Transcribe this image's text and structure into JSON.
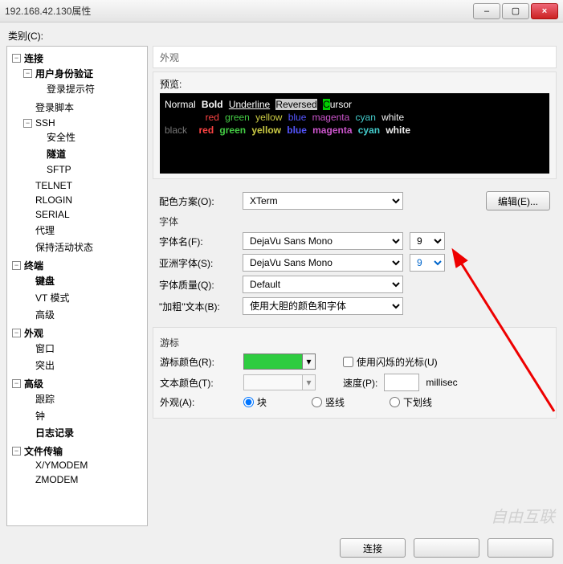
{
  "window": {
    "title": "192.168.42.130属性",
    "min": "–",
    "max": "▢",
    "close": "×"
  },
  "category_label": "类别(C):",
  "tree": {
    "connection": "连接",
    "auth": "用户身份验证",
    "login_prompt": "登录提示符",
    "login_script": "登录脚本",
    "ssh": "SSH",
    "security": "安全性",
    "tunnel": "隧道",
    "sftp": "SFTP",
    "telnet": "TELNET",
    "rlogin": "RLOGIN",
    "serial": "SERIAL",
    "proxy": "代理",
    "keepalive": "保持活动状态",
    "terminal": "终端",
    "keyboard": "键盘",
    "vtmode": "VT 模式",
    "adv1": "高级",
    "appearance": "外观",
    "window": "窗口",
    "highlight": "突出",
    "advanced": "高级",
    "trace": "跟踪",
    "bell": "钟",
    "log": "日志记录",
    "filetransfer": "文件传输",
    "xymodem": "X/YMODEM",
    "zmodem": "ZMODEM"
  },
  "crumb": "外观",
  "preview_label": "预览:",
  "terminal": {
    "normal": "Normal",
    "bold": "Bold",
    "underline": "Underline",
    "reversed": "Reversed",
    "cursorC": "C",
    "cursorRest": "ursor",
    "red": "red",
    "green": "green",
    "yellow": "yellow",
    "blue": "blue",
    "magenta": "magenta",
    "cyan": "cyan",
    "white": "white",
    "black": "black"
  },
  "scheme_label": "配色方案(O):",
  "scheme_value": "XTerm",
  "edit_btn": "编辑(E)...",
  "font_section": "字体",
  "font_name_label": "字体名(F):",
  "font_name_value": "DejaVu Sans Mono",
  "font_size": "9",
  "asian_font_label": "亚洲字体(S):",
  "asian_font_value": "DejaVu Sans Mono",
  "asian_font_size": "9",
  "font_quality_label": "字体质量(Q):",
  "font_quality_value": "Default",
  "bold_text_label": "\"加粗\"文本(B):",
  "bold_text_value": "使用大胆的颜色和字体",
  "cursor_section": "游标",
  "cursor_color_label": "游标颜色(R):",
  "use_blink_label": "使用闪烁的光标(U)",
  "text_color_label": "文本颜色(T):",
  "speed_label": "速度(P):",
  "speed_unit": "millisec",
  "appearance_label": "外观(A):",
  "opt_block": "块",
  "opt_vline": "竖线",
  "opt_underline": "下划线",
  "connect_btn": "连接",
  "watermark": "自由互联"
}
